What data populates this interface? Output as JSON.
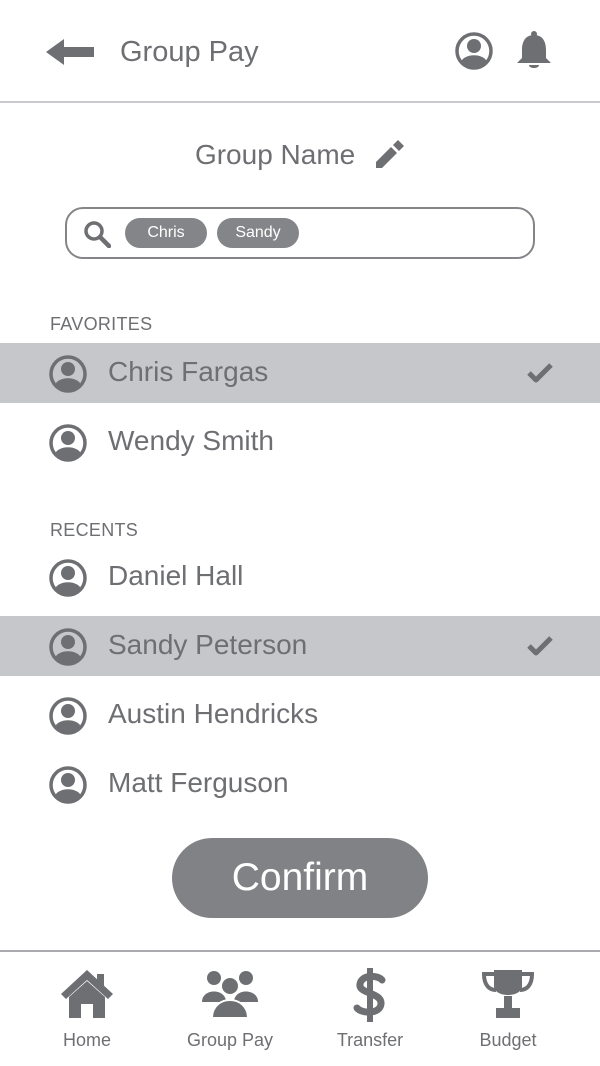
{
  "header": {
    "title": "Group Pay"
  },
  "group": {
    "name": "Group Name"
  },
  "search": {
    "chips": [
      "Chris",
      "Sandy"
    ]
  },
  "favorites": {
    "label": "FAVORITES",
    "contacts": [
      {
        "name": "Chris Fargas",
        "selected": true
      },
      {
        "name": "Wendy Smith",
        "selected": false
      }
    ]
  },
  "recents": {
    "label": "RECENTS",
    "contacts": [
      {
        "name": "Daniel Hall",
        "selected": false
      },
      {
        "name": "Sandy Peterson",
        "selected": true
      },
      {
        "name": "Austin Hendricks",
        "selected": false
      },
      {
        "name": "Matt Ferguson",
        "selected": false
      }
    ]
  },
  "confirm_label": "Confirm",
  "bottom_nav": {
    "items": [
      {
        "label": "Home",
        "icon": "home-icon"
      },
      {
        "label": "Group Pay",
        "icon": "group-icon"
      },
      {
        "label": "Transfer",
        "icon": "dollar-icon"
      },
      {
        "label": "Budget",
        "icon": "trophy-icon"
      }
    ]
  },
  "colors": {
    "text": "#6e6f72",
    "selected_row": "#c6c7ca",
    "chip": "#848588",
    "button": "#818285",
    "icon": "#6e6f72"
  }
}
